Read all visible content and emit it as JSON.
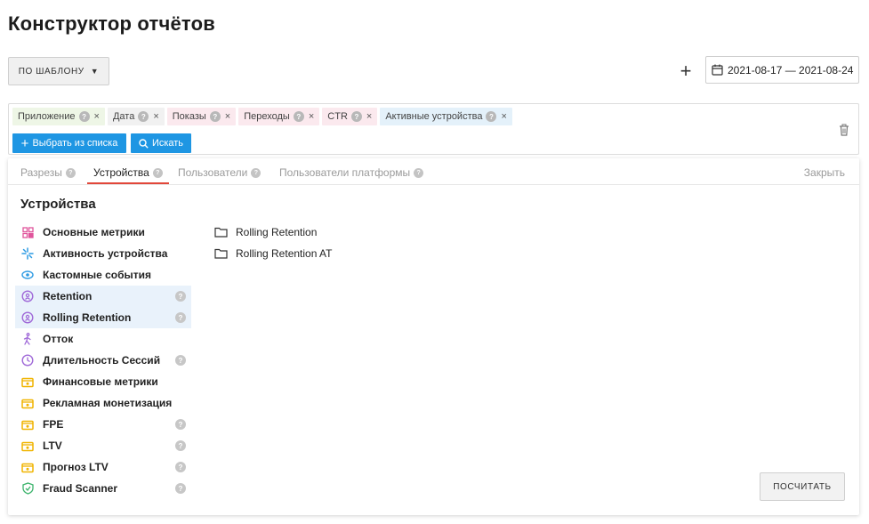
{
  "page_title": "Конструктор отчётов",
  "template_button": "ПО ШАБЛОНУ",
  "date_range": "2021-08-17 — 2021-08-24",
  "add_button_glyph": "+",
  "chips": [
    {
      "label": "Приложение",
      "color": "green"
    },
    {
      "label": "Дата",
      "color": "grey"
    },
    {
      "label": "Показы",
      "color": "pink"
    },
    {
      "label": "Переходы",
      "color": "pink"
    },
    {
      "label": "CTR",
      "color": "pink"
    },
    {
      "label": "Активные устройства",
      "color": "blue"
    }
  ],
  "pick_button": "Выбрать из списка",
  "search_button": "Искать",
  "tabs": [
    {
      "label": "Разрезы",
      "active": false
    },
    {
      "label": "Устройства",
      "active": true
    },
    {
      "label": "Пользователи",
      "active": false
    },
    {
      "label": "Пользователи платформы",
      "active": false
    }
  ],
  "close_label": "Закрыть",
  "section_title": "Устройства",
  "menu": [
    {
      "label": "Основные метрики",
      "icon": "grid-icon",
      "color": "#e0559c",
      "help": false,
      "selected": false
    },
    {
      "label": "Активность устройства",
      "icon": "activity-icon",
      "color": "#2e9be3",
      "help": false,
      "selected": false
    },
    {
      "label": "Кастомные события",
      "icon": "events-icon",
      "color": "#2e9be3",
      "help": false,
      "selected": false
    },
    {
      "label": "Retention",
      "icon": "retention-icon",
      "color": "#a06ad8",
      "help": true,
      "selected": true
    },
    {
      "label": "Rolling Retention",
      "icon": "retention-icon",
      "color": "#a06ad8",
      "help": true,
      "selected": true
    },
    {
      "label": "Отток",
      "icon": "walk-icon",
      "color": "#a06ad8",
      "help": false,
      "selected": false
    },
    {
      "label": "Длительность Сессий",
      "icon": "clock-icon",
      "color": "#a06ad8",
      "help": true,
      "selected": false
    },
    {
      "label": "Финансовые метрики",
      "icon": "money-icon",
      "color": "#f0b400",
      "help": false,
      "selected": false
    },
    {
      "label": "Рекламная монетизация",
      "icon": "money-icon",
      "color": "#f0b400",
      "help": false,
      "selected": false
    },
    {
      "label": "FPE",
      "icon": "money-icon",
      "color": "#f0b400",
      "help": true,
      "selected": false
    },
    {
      "label": "LTV",
      "icon": "money-icon",
      "color": "#f0b400",
      "help": true,
      "selected": false
    },
    {
      "label": "Прогноз LTV",
      "icon": "money-icon",
      "color": "#f0b400",
      "help": true,
      "selected": false
    },
    {
      "label": "Fraud Scanner",
      "icon": "shield-icon",
      "color": "#3bb36b",
      "help": true,
      "selected": false
    }
  ],
  "folders": [
    {
      "label": "Rolling Retention"
    },
    {
      "label": "Rolling Retention AT"
    }
  ],
  "calc_button": "ПОСЧИТАТЬ"
}
